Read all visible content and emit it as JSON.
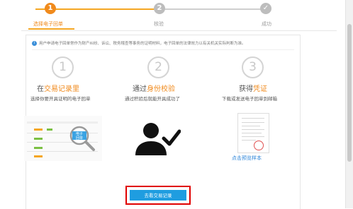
{
  "steps": [
    {
      "num": "1",
      "label": "选择电子回单",
      "state": "active"
    },
    {
      "num": "2",
      "label": "核验",
      "state": "pending"
    },
    {
      "num": "✓",
      "label": "成功",
      "state": "pending"
    }
  ],
  "notice": "用户申请电子回单常作为财产纠纷、诉讼、税务稽查等事务的证明材料，电子回单的法律效力以有关机关实际判断为准。",
  "columns": [
    {
      "number": "1",
      "title_prefix": "在",
      "title_highlight": "交易记录里",
      "subtitle": "选择你要开具证明的电子回单"
    },
    {
      "number": "2",
      "title_prefix": "通过",
      "title_highlight": "身份校验",
      "subtitle": "通过积验后就能开具成功了"
    },
    {
      "number": "3",
      "title_prefix": "获得",
      "title_highlight": "凭证",
      "subtitle": "下载或发送电子回单到邮箱"
    }
  ],
  "magnifier_text": "电子回单",
  "preview_link": "点击预览样本",
  "primary_button": "去看交易记录",
  "colors": {
    "accent": "#f08a1c",
    "button": "#1f9de0",
    "highlight_box": "#e00000",
    "link": "#2b84d8"
  }
}
